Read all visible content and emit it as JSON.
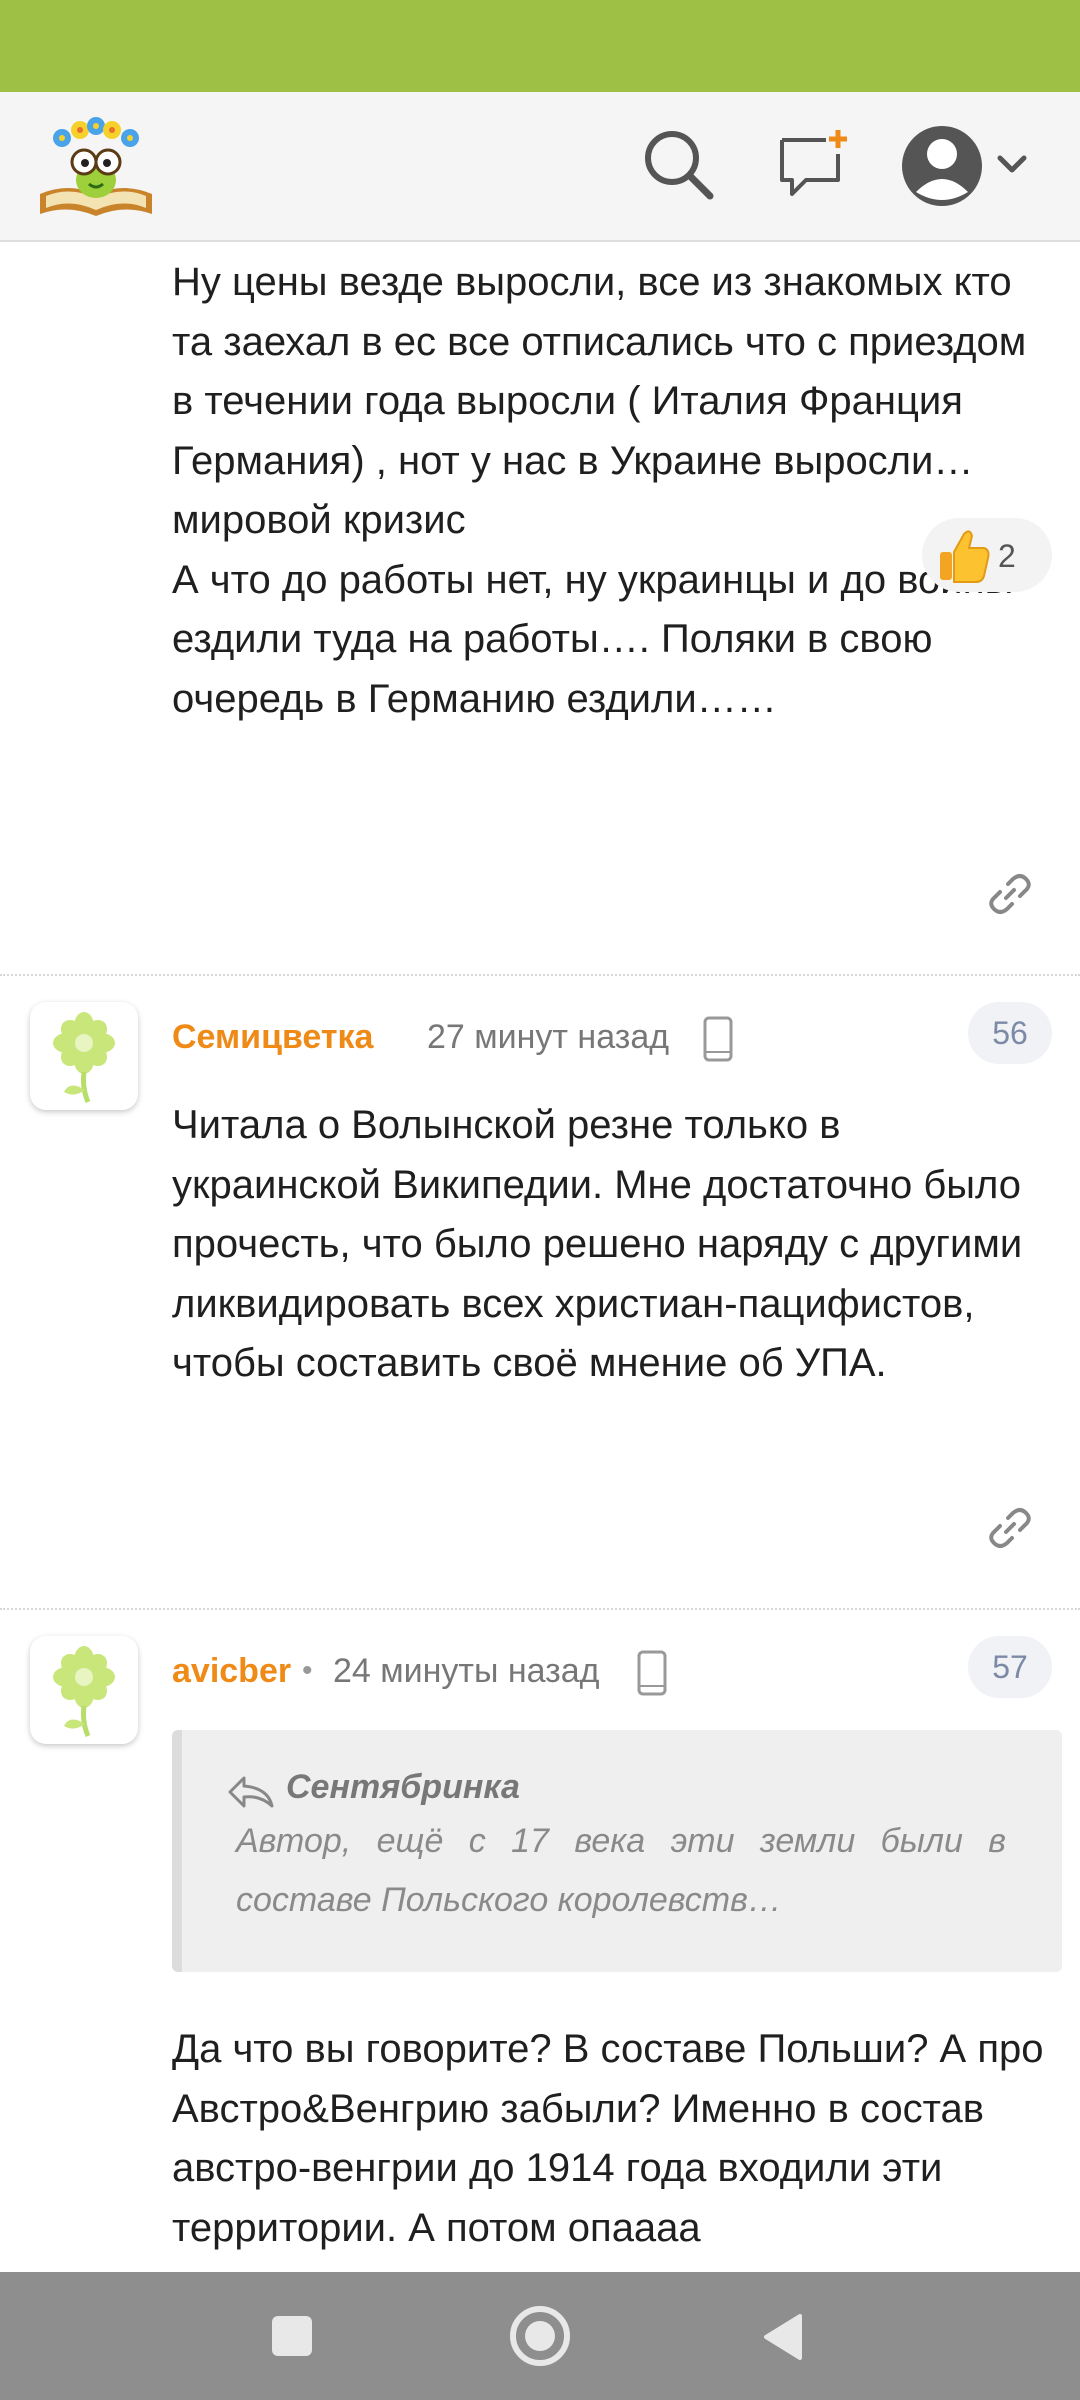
{
  "header": {
    "logo_icon": "smiling-book-logo-icon",
    "search_icon": "search-icon",
    "new_topic_icon": "new-message-plus-icon",
    "profile_icon": "user-avatar-icon",
    "dropdown_icon": "chevron-down-icon"
  },
  "colors": {
    "accent": "#9dc045",
    "author": "#ef8a17",
    "badge_text": "#7c8aa6"
  },
  "comments": [
    {
      "text_lines": [
        "Ну цены везде выросли, все из знакомых кто та заехал в ес все отписались что с приездом в течении года выросли ( Италия Франция Германия) , нот у нас в Украине выросли… мировой кризис",
        "А что до работы нет, ну украинцы и до войны ездили туда на работы…. Поляки в свою очередь в Германию ездили……"
      ],
      "likes": "2",
      "like_icon": "thumbs-up-icon",
      "link_icon": "link-icon"
    },
    {
      "author": "Семицветка",
      "time": "27 минут назад",
      "device_icon": "mobile-phone-icon",
      "number": "56",
      "avatar_icon": "flower-avatar-icon",
      "text": "Читала о Волынской резне только в украинской Википедии. Мне достаточно было прочесть, что было решено наряду с другими ликвидировать всех христиан-пацифистов, чтобы составить своё мнение об УПА.",
      "link_icon": "link-icon"
    },
    {
      "author": "avicber",
      "separator": "•",
      "time": "24 минуты назад",
      "device_icon": "mobile-phone-icon",
      "number": "57",
      "avatar_icon": "flower-avatar-icon",
      "quote": {
        "author": "Сентябринка",
        "text": "Автор, ещё с 17 века эти земли были в составе Польского королевств…",
        "reply_icon": "reply-arrow-icon"
      },
      "text": "Да что вы говорите? В составе Польши? А про Австро&Венгрию забыли? Именно в состав австро-венгрии до 1914 года входили эти территории. А потом опаааа "
    }
  ],
  "navbar": {
    "recent_icon": "square-icon",
    "home_icon": "circle-icon",
    "back_icon": "triangle-back-icon"
  }
}
